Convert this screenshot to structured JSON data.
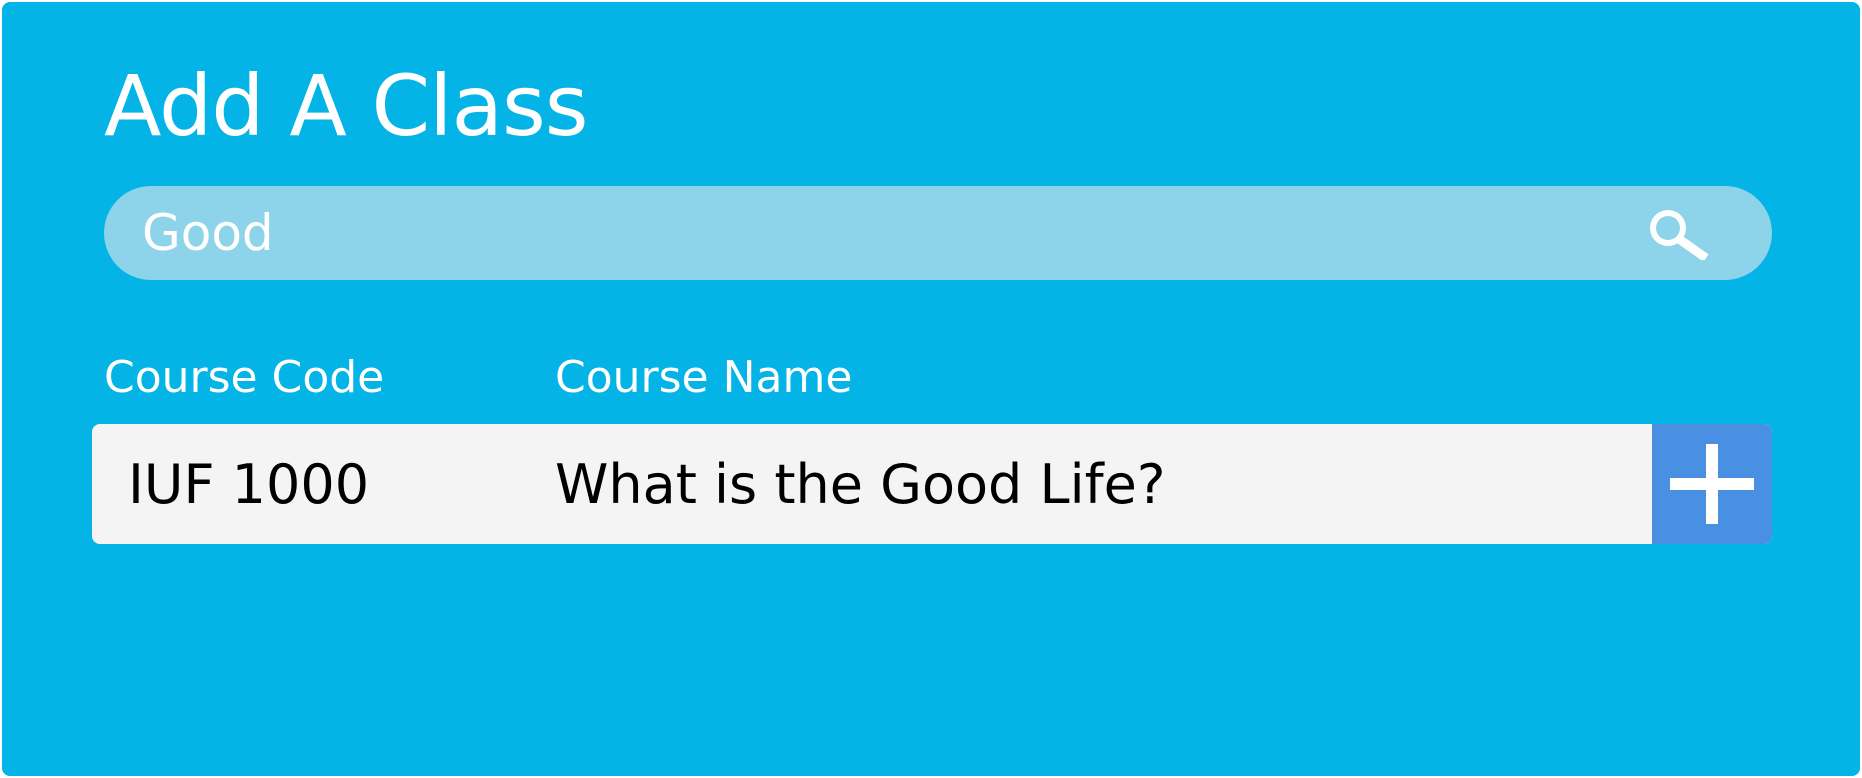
{
  "header": {
    "title": "Add A Class"
  },
  "search": {
    "value": "Good",
    "icon": "search-icon"
  },
  "table": {
    "columns": [
      "Course Code",
      "Course Name"
    ],
    "rows": [
      {
        "code": "IUF 1000",
        "name": "What is the Good Life?",
        "action_icon": "plus-icon"
      }
    ]
  },
  "colors": {
    "background": "#04b4e6",
    "search_field": "#8dd4ea",
    "row": "#f4f4f4",
    "add_button": "#4a90e2",
    "text_light": "#ffffff",
    "text_dark": "#000000"
  }
}
